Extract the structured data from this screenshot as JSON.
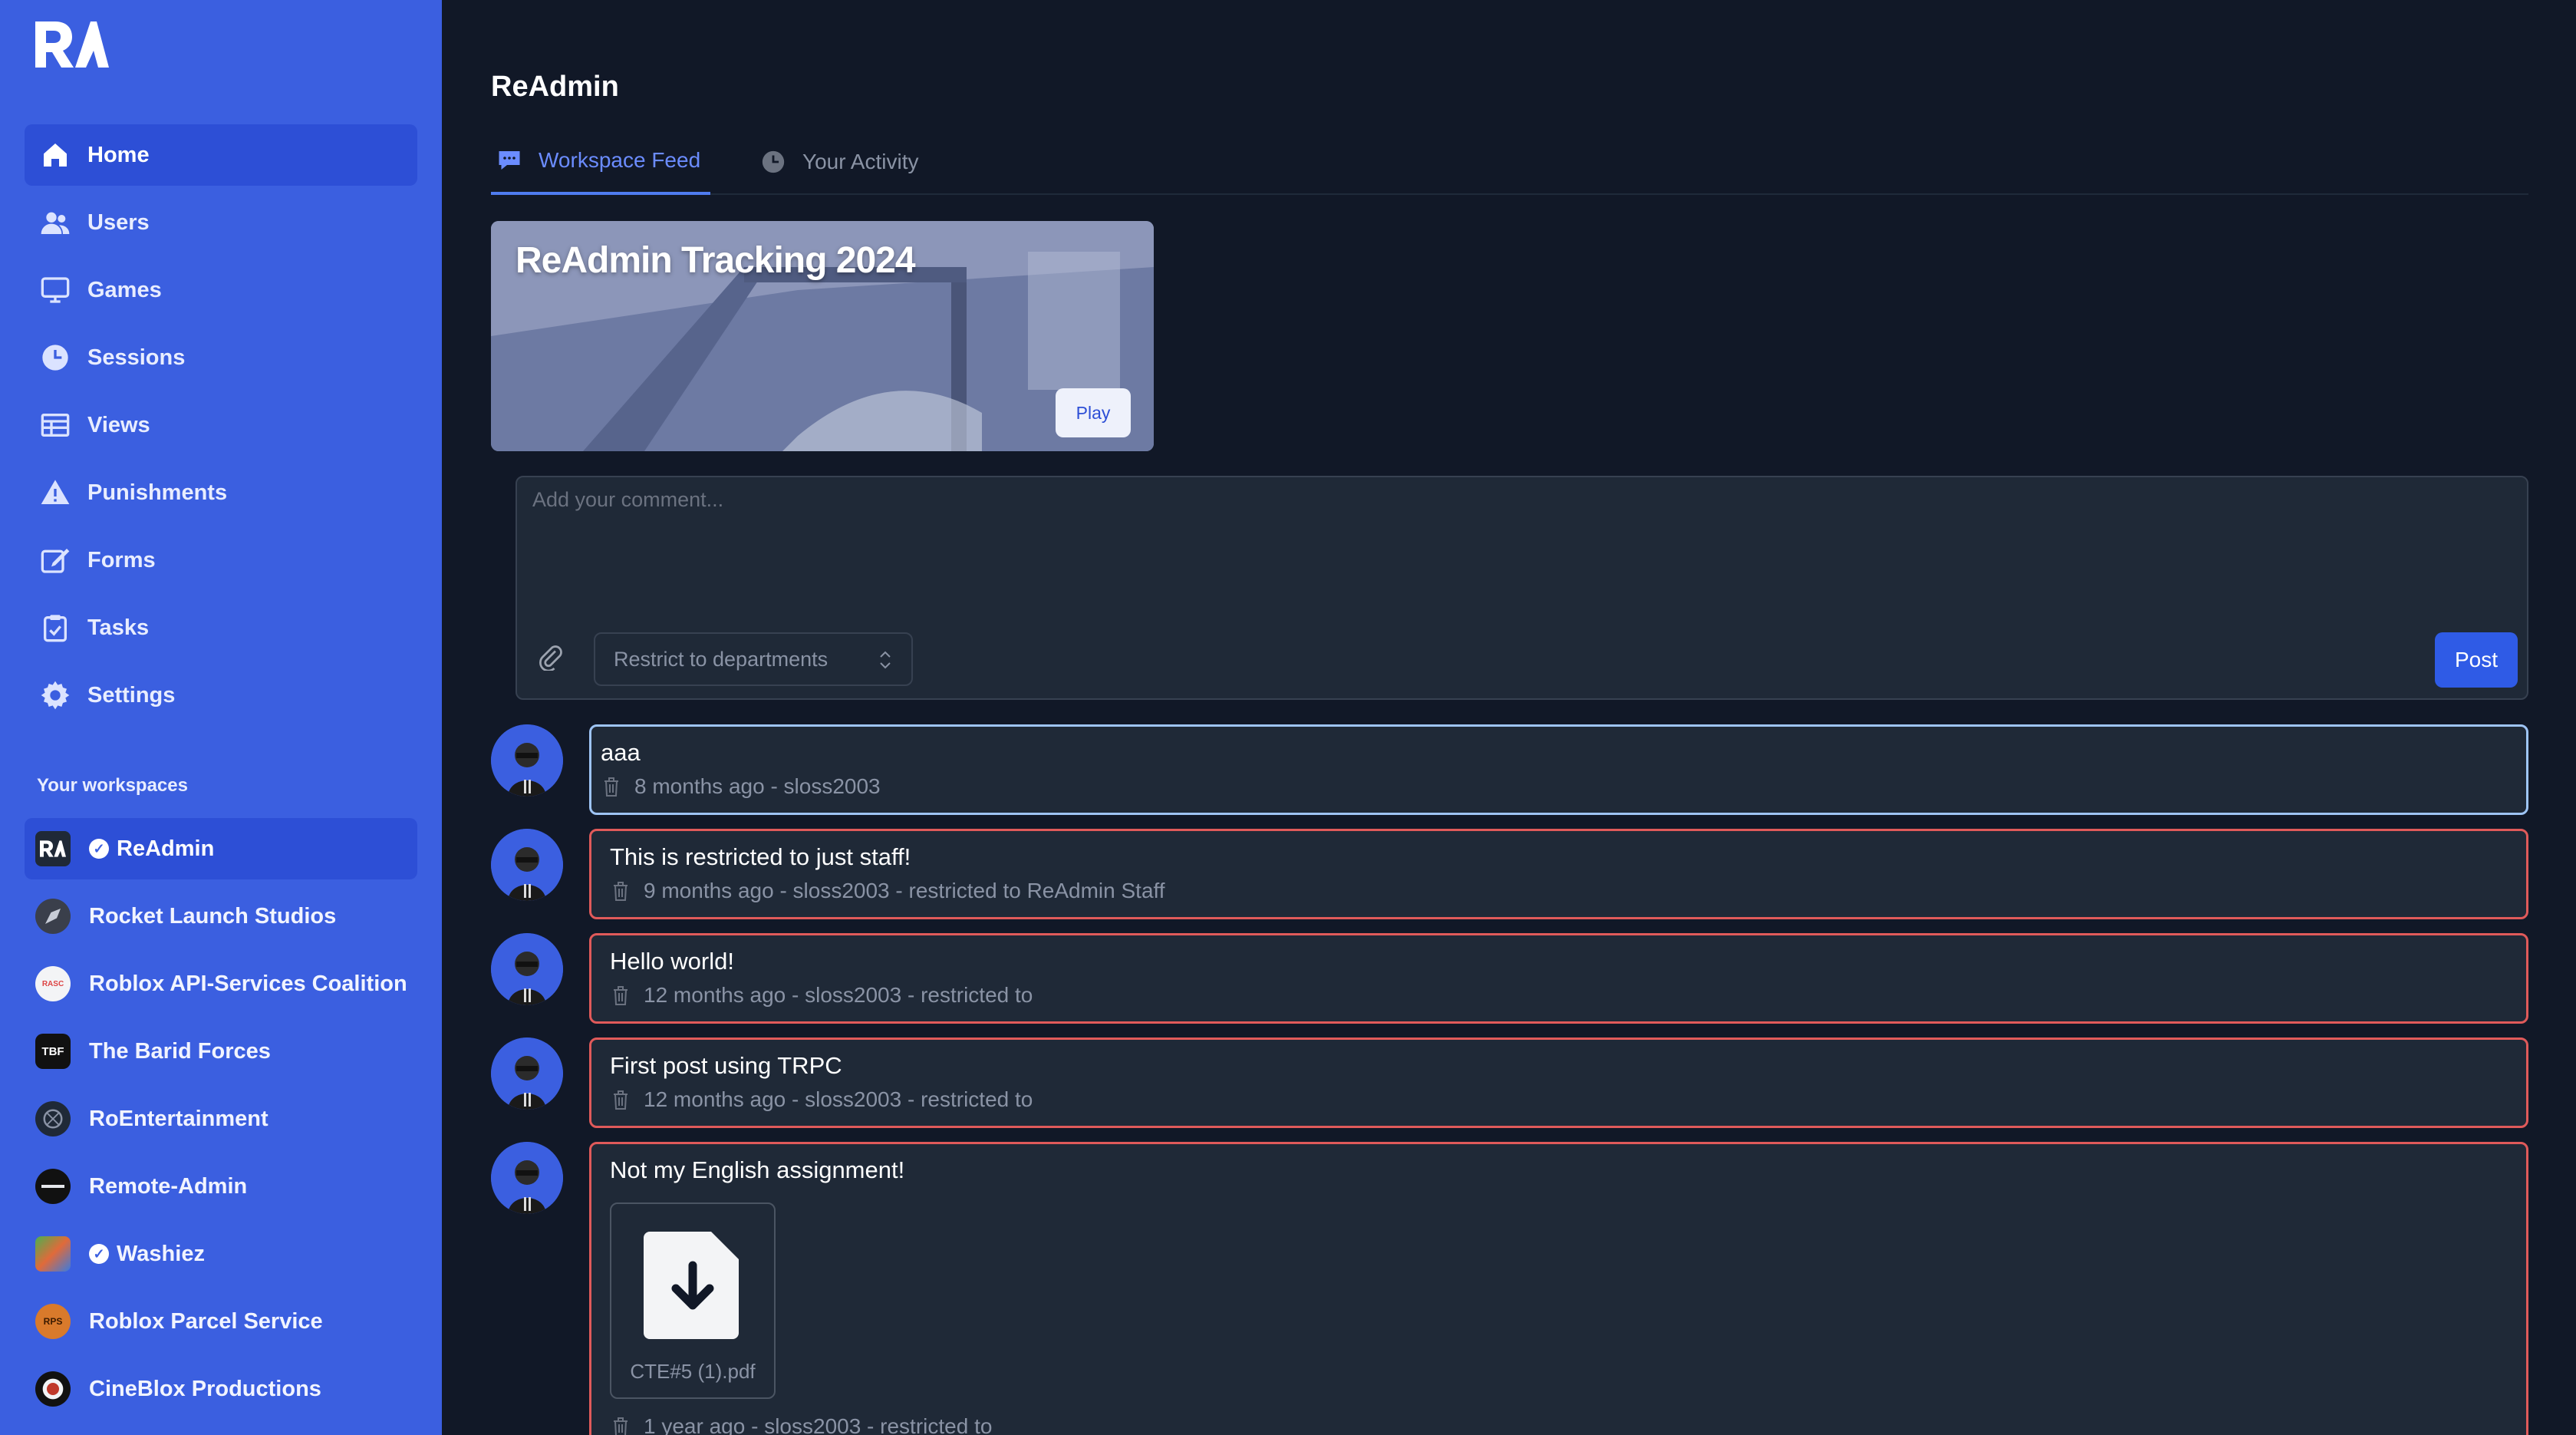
{
  "colors": {
    "sidebar_bg": "#3b5fe0",
    "sidebar_active": "#2d4fd6",
    "main_bg": "#111827",
    "card_bg": "#1f2937",
    "restricted_border": "#e05a5a",
    "highlight_border": "#9ec4f5",
    "accent": "#2f5be6"
  },
  "sidebar": {
    "logo": "RA",
    "nav": [
      {
        "label": "Home",
        "icon": "home-icon"
      },
      {
        "label": "Users",
        "icon": "users-icon"
      },
      {
        "label": "Games",
        "icon": "monitor-icon"
      },
      {
        "label": "Sessions",
        "icon": "clock-icon"
      },
      {
        "label": "Views",
        "icon": "table-icon"
      },
      {
        "label": "Punishments",
        "icon": "warning-icon"
      },
      {
        "label": "Forms",
        "icon": "edit-icon"
      },
      {
        "label": "Tasks",
        "icon": "clipboard-check-icon"
      },
      {
        "label": "Settings",
        "icon": "gear-icon"
      }
    ],
    "workspaces_heading": "Your workspaces",
    "workspaces": [
      {
        "name": "ReAdmin",
        "verified": true,
        "avatar_text": "RA"
      },
      {
        "name": "Rocket Launch Studios",
        "verified": false,
        "avatar_text": ""
      },
      {
        "name": "Roblox API-Services Coalition",
        "verified": false,
        "avatar_text": "RASC"
      },
      {
        "name": "The Barid Forces",
        "verified": false,
        "avatar_text": "TBF"
      },
      {
        "name": "RoEntertainment",
        "verified": false,
        "avatar_text": ""
      },
      {
        "name": "Remote-Admin",
        "verified": false,
        "avatar_text": ""
      },
      {
        "name": "Washiez",
        "verified": true,
        "avatar_text": ""
      },
      {
        "name": "Roblox Parcel Service",
        "verified": false,
        "avatar_text": "RPS"
      },
      {
        "name": "CineBlox Productions",
        "verified": false,
        "avatar_text": ""
      }
    ]
  },
  "main": {
    "title": "ReAdmin",
    "tabs": [
      {
        "label": "Workspace Feed",
        "icon": "chat-bubble-icon"
      },
      {
        "label": "Your Activity",
        "icon": "clock-icon"
      }
    ],
    "banner": {
      "title": "ReAdmin Tracking 2024",
      "play_label": "Play"
    },
    "composer": {
      "placeholder": "Add your comment...",
      "restrict_label": "Restrict to departments",
      "post_label": "Post"
    },
    "posts": [
      {
        "content": "aaa",
        "meta": "8 months ago - sloss2003",
        "highlighted": true
      },
      {
        "content": "This is restricted to just staff!",
        "meta": "9 months ago - sloss2003 - restricted to ReAdmin Staff",
        "highlighted": false
      },
      {
        "content": "Hello world!",
        "meta": "12 months ago - sloss2003 - restricted to",
        "highlighted": false
      },
      {
        "content": "First post using TRPC",
        "meta": "12 months ago - sloss2003 - restricted to",
        "highlighted": false
      },
      {
        "content": "Not my English assignment!",
        "attachment": "CTE#5 (1).pdf",
        "meta": "1 year ago - sloss2003 - restricted to",
        "highlighted": false
      }
    ]
  }
}
